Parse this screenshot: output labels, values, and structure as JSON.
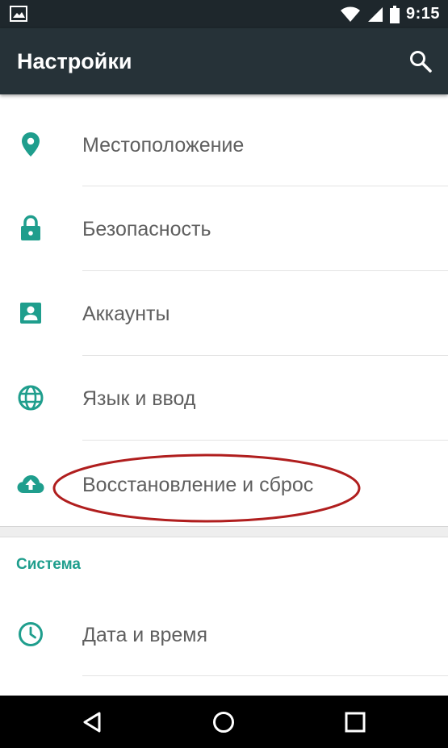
{
  "status_bar": {
    "time": "9:15",
    "icons": [
      "image-notification-icon",
      "wifi-icon",
      "signal-icon",
      "battery-icon"
    ]
  },
  "app_bar": {
    "title": "Настройки",
    "search_icon": "search-icon"
  },
  "settings": {
    "items": [
      {
        "label": "Местоположение",
        "icon": "location-icon"
      },
      {
        "label": "Безопасность",
        "icon": "lock-icon"
      },
      {
        "label": "Аккаунты",
        "icon": "account-icon"
      },
      {
        "label": "Язык и ввод",
        "icon": "globe-icon"
      },
      {
        "label": "Восстановление и сброс",
        "icon": "cloud-upload-icon"
      }
    ],
    "section_title": "Система",
    "system_items": [
      {
        "label": "Дата и время",
        "icon": "clock-icon"
      }
    ]
  },
  "nav_bar": {
    "buttons": [
      "back-icon",
      "home-icon",
      "recents-icon"
    ]
  },
  "colors": {
    "status_bar": "#1e272c",
    "app_bar": "#263238",
    "accent": "#1f9e8d",
    "annotation": "#b01e1e"
  }
}
